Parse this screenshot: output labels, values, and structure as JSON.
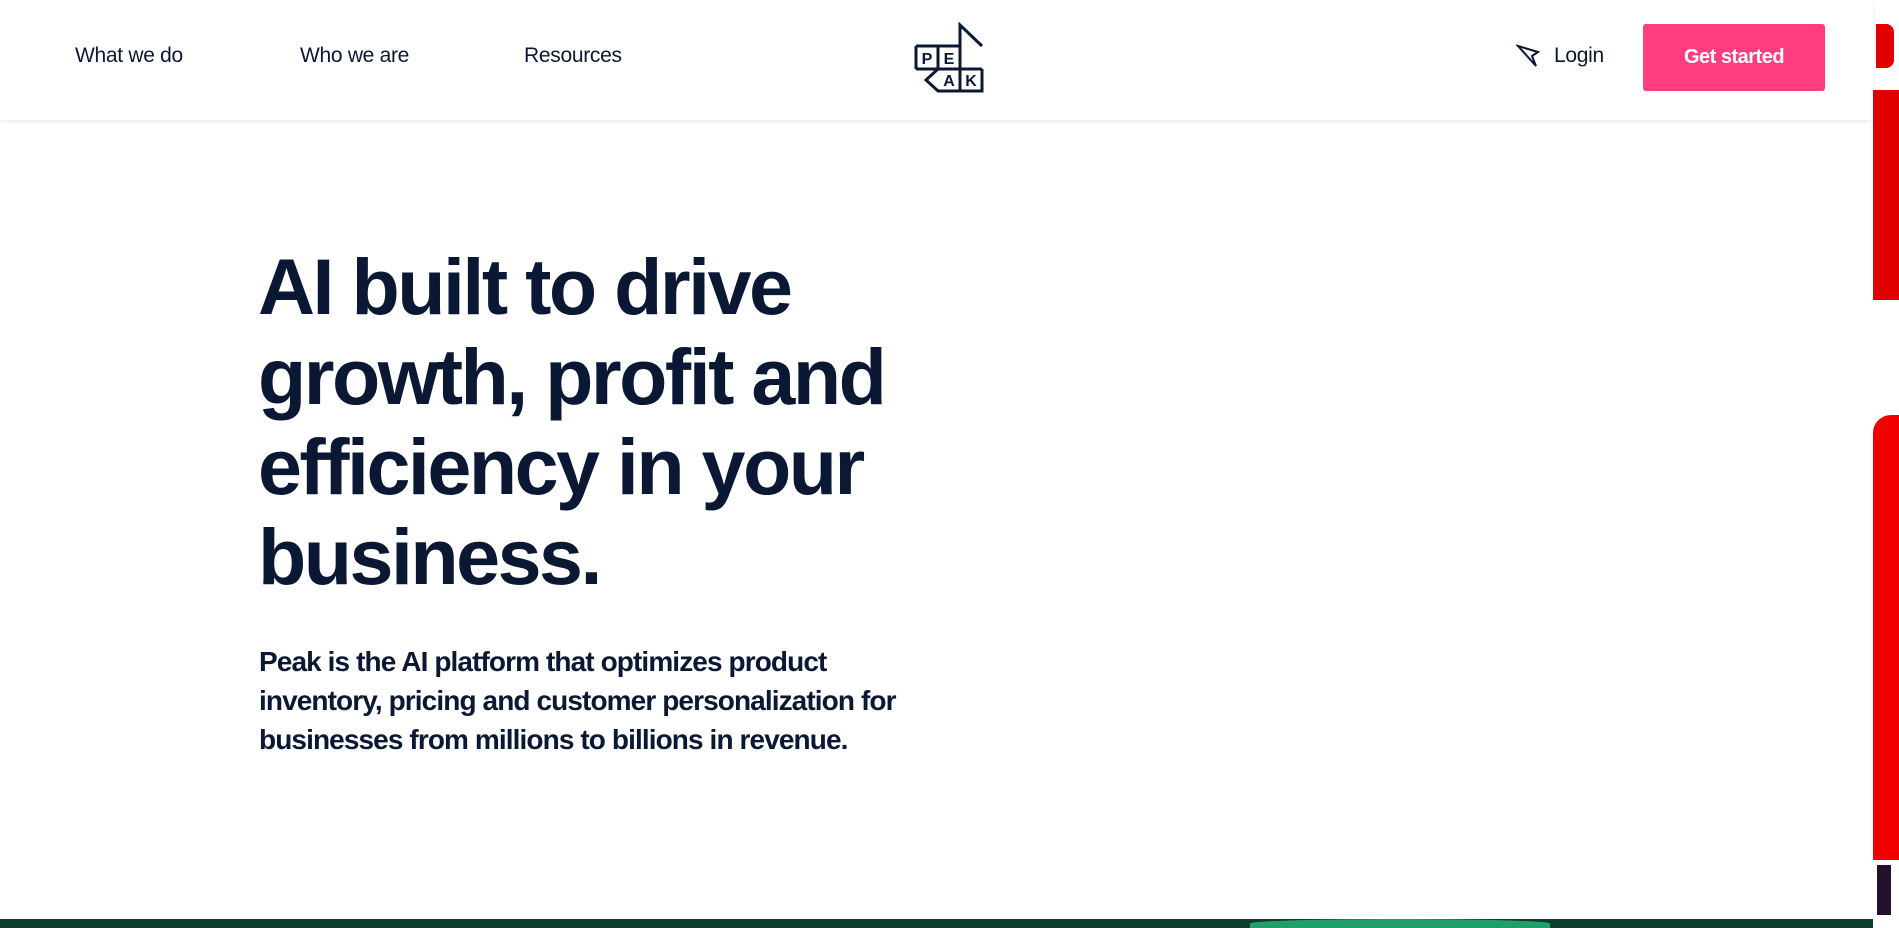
{
  "nav": {
    "items": [
      {
        "label": "What we do"
      },
      {
        "label": "Who we are"
      },
      {
        "label": "Resources"
      }
    ],
    "logo_letters": [
      "P",
      "E",
      "A",
      "K"
    ],
    "login_label": "Login",
    "cta_label": "Get started"
  },
  "hero": {
    "title": "AI built to drive growth, profit and efficiency in your business.",
    "subtitle": "Peak is the AI platform that optimizes product inventory, pricing and customer personalization for businesses from millions to billions in revenue."
  },
  "colors": {
    "brand_navy": "#0b1833",
    "cta_pink": "#ff3d7f",
    "accent_red": "#e00000",
    "footer_green": "#0d3b2e"
  },
  "icons": {
    "login": "cursor-arrow-icon",
    "logo": "peak-logo"
  }
}
